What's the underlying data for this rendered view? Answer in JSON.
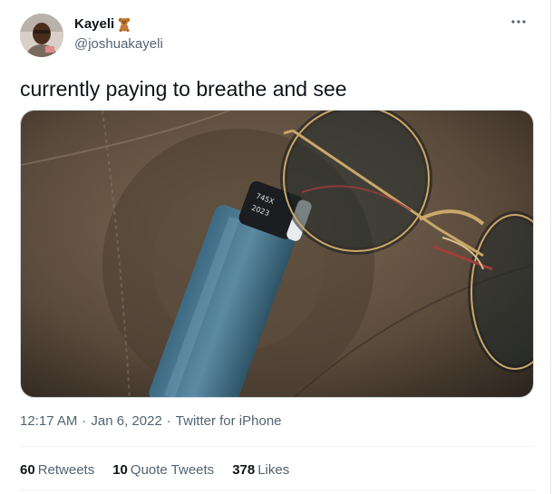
{
  "user": {
    "display_name": "Kayeli",
    "handle": "@joshuakayeli",
    "badge_icon": "teddy-bear-icon"
  },
  "tweet": {
    "text": "currently paying to breathe and see",
    "time": "12:17 AM",
    "date": "Jan 6, 2022",
    "source": "Twitter for iPhone",
    "separator": "·"
  },
  "media": {
    "inhaler_label_line1": "745X",
    "inhaler_label_line2": "2023"
  },
  "stats": {
    "retweets": {
      "count": "60",
      "label": "Retweets"
    },
    "quote_tweets": {
      "count": "10",
      "label": "Quote Tweets"
    },
    "likes": {
      "count": "378",
      "label": "Likes"
    }
  },
  "more_icon": "ellipsis-icon",
  "colors": {
    "text": "#0f1419",
    "muted": "#536471",
    "divider": "#eff3f4"
  }
}
